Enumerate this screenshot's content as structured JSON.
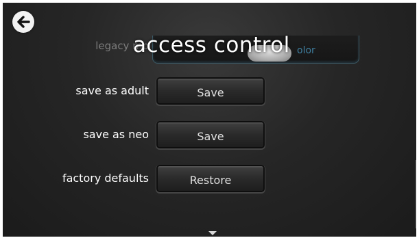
{
  "title": "access control",
  "ghost_row": {
    "label": "legacy mo",
    "switch_text": "olor"
  },
  "rows": [
    {
      "label": "save as adult",
      "button": "Save"
    },
    {
      "label": "save as neo",
      "button": "Save"
    },
    {
      "label": "factory defaults",
      "button": "Restore"
    }
  ],
  "colors": {
    "accent": "#3f7fa0",
    "text": "#ffffff",
    "background": "#262626"
  }
}
